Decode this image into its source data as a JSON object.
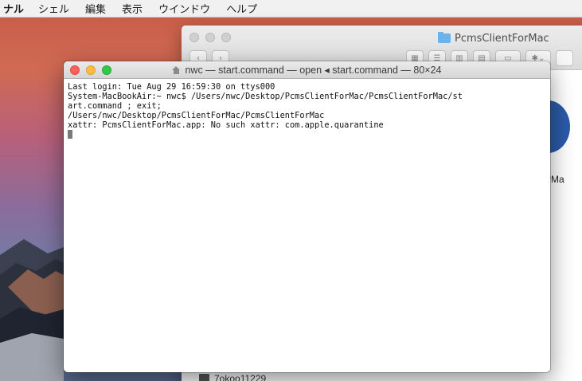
{
  "menubar": {
    "items": [
      "ナル",
      "シェル",
      "編集",
      "表示",
      "ウインドウ",
      "ヘルプ"
    ]
  },
  "finder": {
    "title": "PcmsClientForMac",
    "partial_label": "rMa",
    "bottom_item": "7okoo11229"
  },
  "terminal": {
    "title": "nwc — start.command — open ◂ start.command — 80×24",
    "lines": [
      "Last login: Tue Aug 29 16:59:30 on ttys000",
      "System-MacBookAir:~ nwc$ /Users/nwc/Desktop/PcmsClientForMac/PcmsClientForMac/st",
      "art.command ; exit;",
      "/Users/nwc/Desktop/PcmsClientForMac/PcmsClientForMac",
      "xattr: PcmsClientForMac.app: No such xattr: com.apple.quarantine"
    ]
  },
  "colors": {
    "close": "#fc605c",
    "minimize": "#fdbc40",
    "maximize": "#34c84a"
  }
}
